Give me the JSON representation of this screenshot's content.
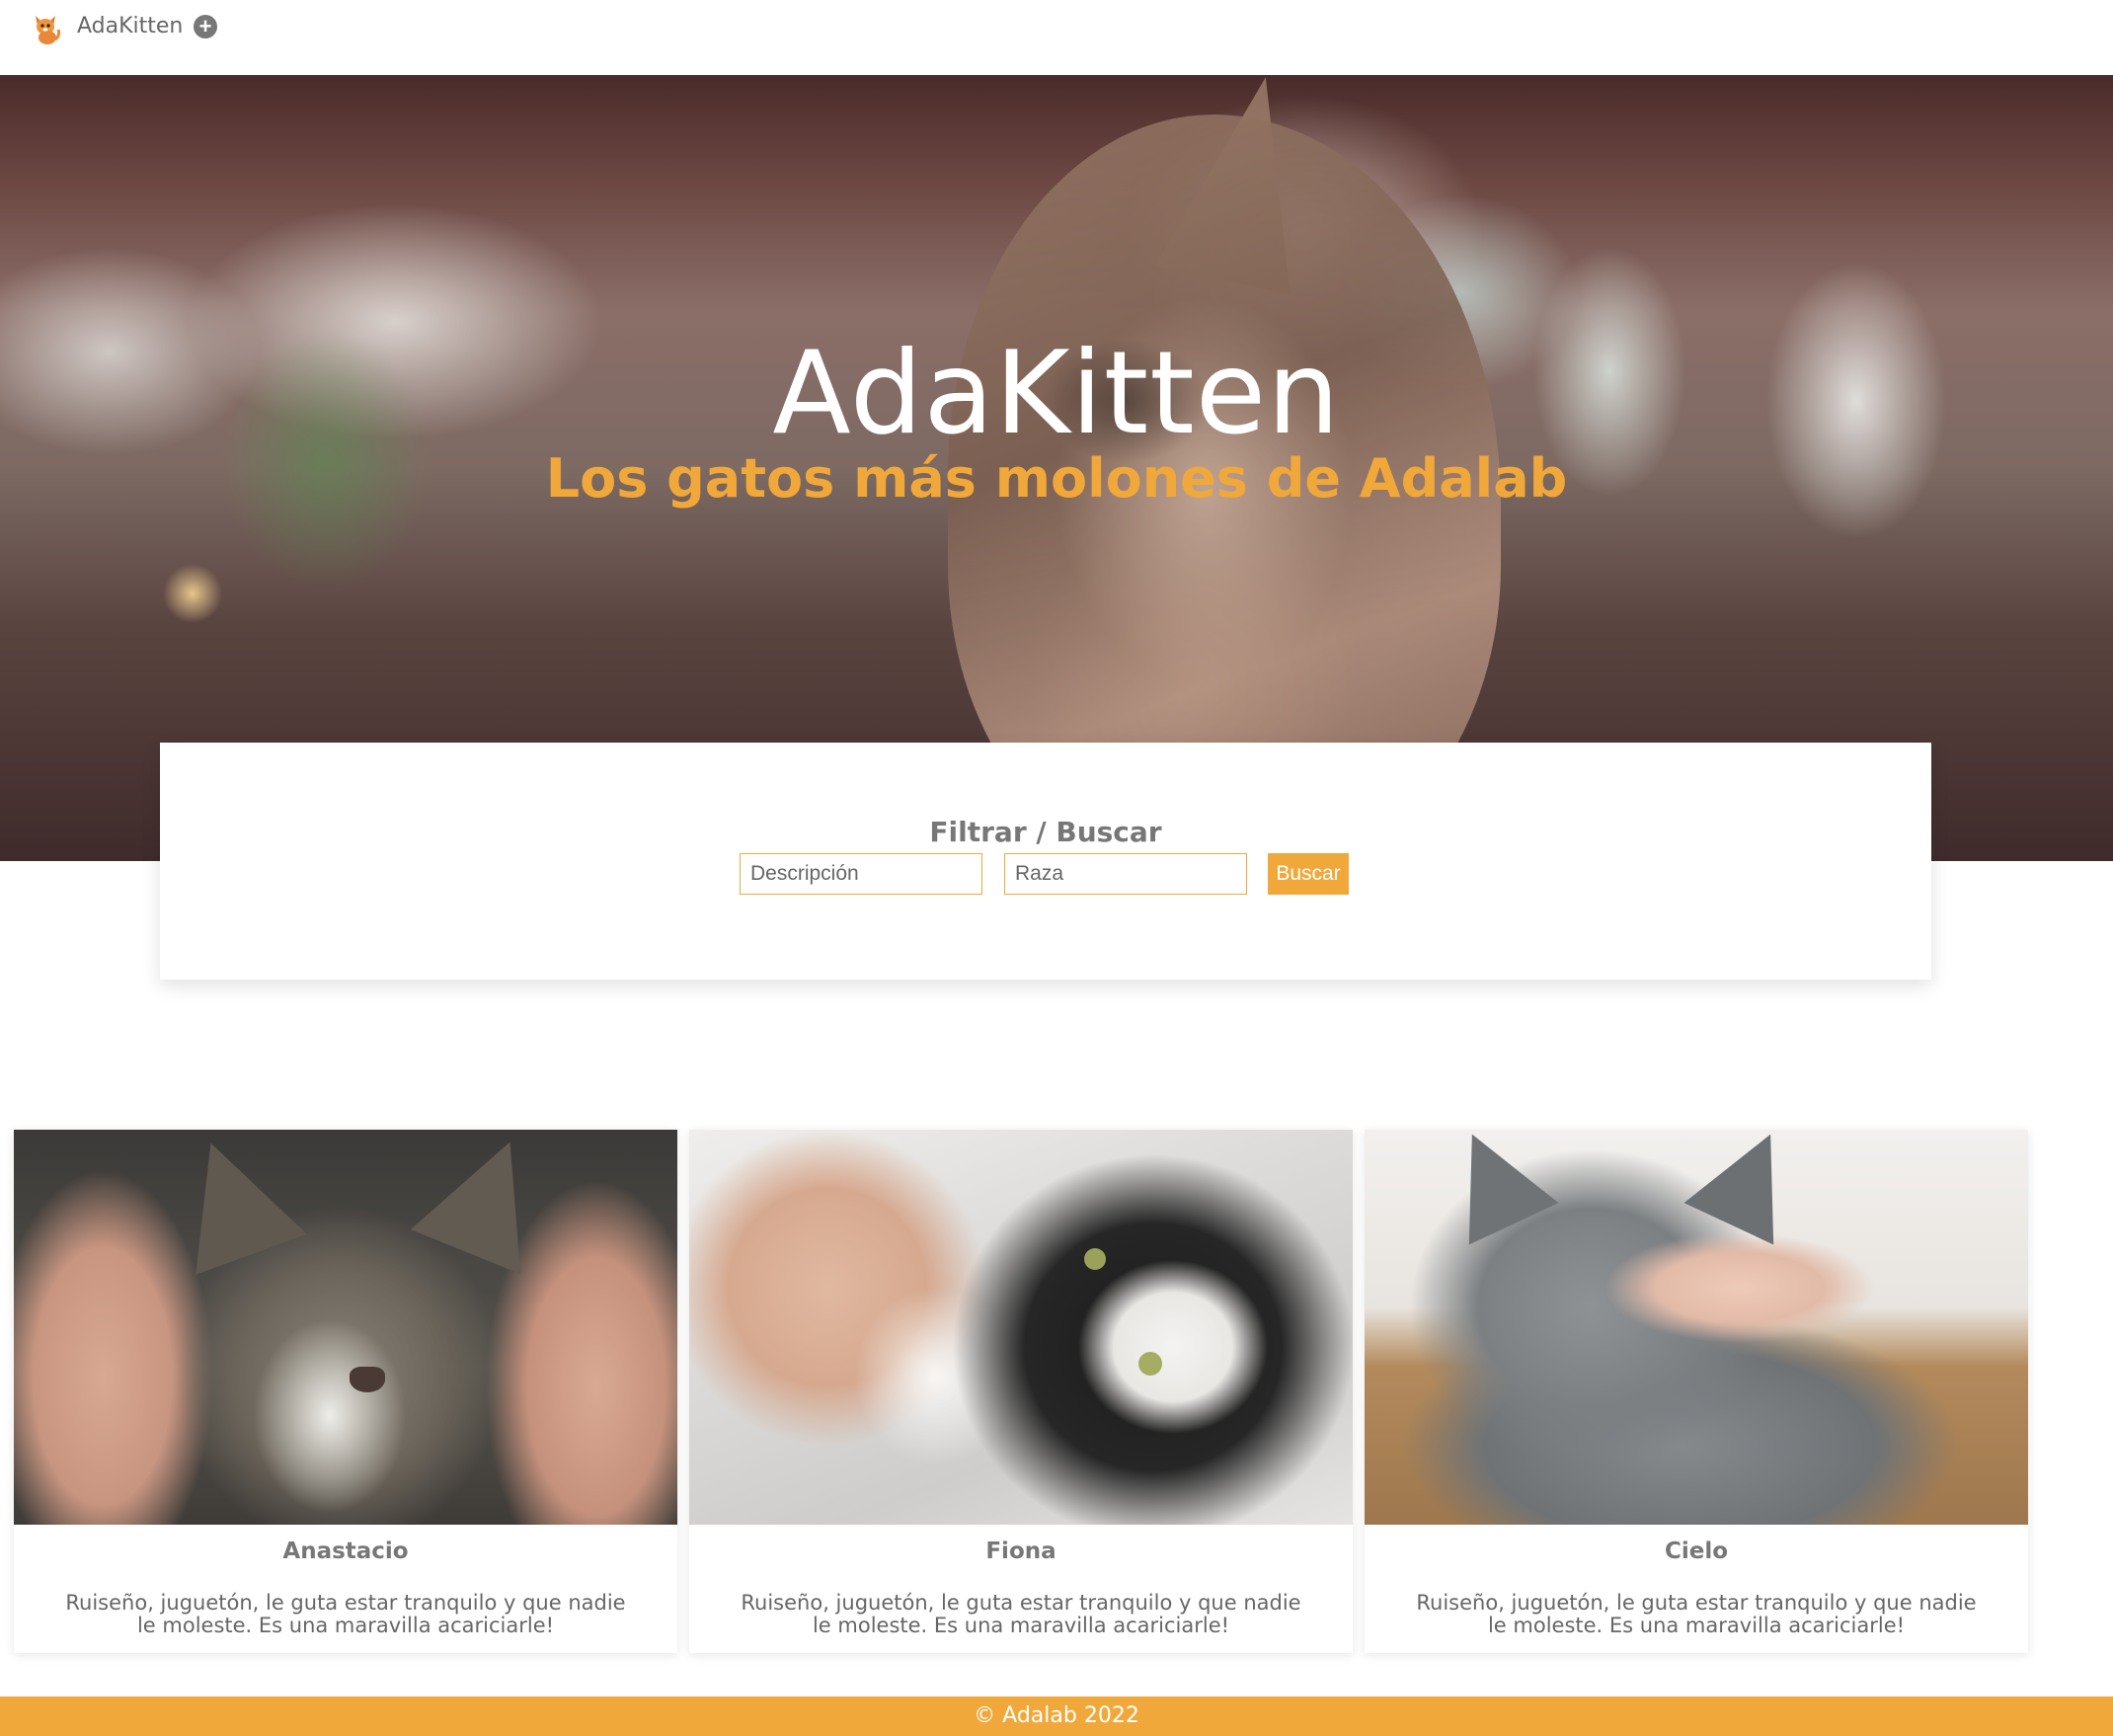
{
  "nav": {
    "brand": "AdaKitten",
    "logo_icon": "kitten-logo-icon",
    "add_icon": "plus-circle-icon"
  },
  "hero": {
    "title": "AdaKitten",
    "subtitle": "Los gatos más molones de Adalab"
  },
  "filter": {
    "title": "Filtrar / Buscar",
    "description_placeholder": "Descripción",
    "breed_placeholder": "Raza",
    "search_label": "Buscar"
  },
  "cats": [
    {
      "name": "Anastacio",
      "description": "Ruiseño, juguetón, le guta estar tranquilo y que nadie le moleste. Es una maravilla acariciarle!"
    },
    {
      "name": "Fiona",
      "description": "Ruiseño, juguetón, le guta estar tranquilo y que nadie le moleste. Es una maravilla acariciarle!"
    },
    {
      "name": "Cielo",
      "description": "Ruiseño, juguetón, le guta estar tranquilo y que nadie le moleste. Es una maravilla acariciarle!"
    }
  ],
  "footer": {
    "text": "© Adalab 2022"
  },
  "colors": {
    "accent": "#f1a83a",
    "text": "#666666"
  }
}
